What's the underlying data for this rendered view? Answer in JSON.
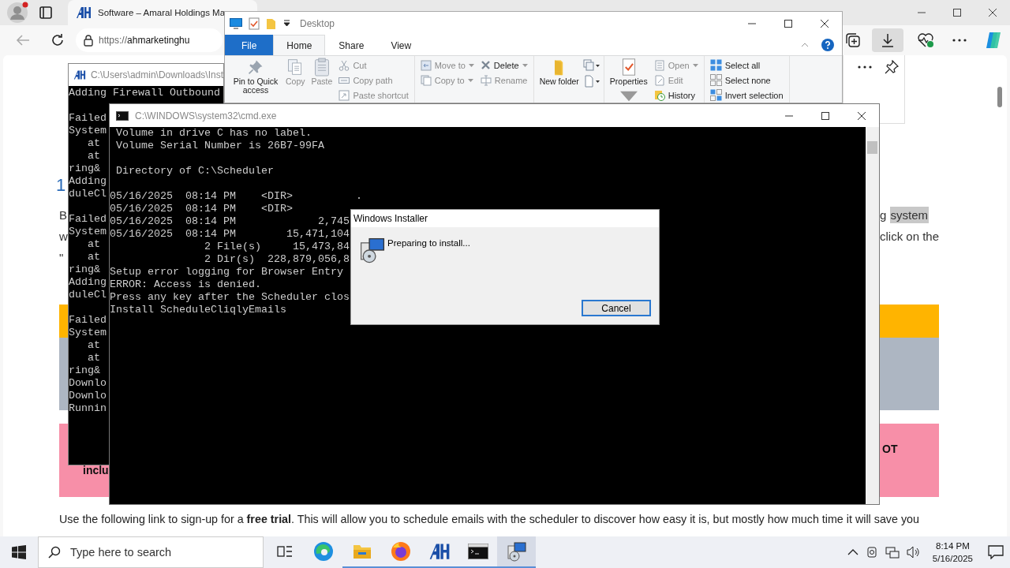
{
  "browser": {
    "tab_title": "Software – Amaral Holdings Ma",
    "address_scheme": "https://",
    "address_host": "ahmarketinghu",
    "downloads_active": true,
    "page": {
      "heading_number": "1",
      "left_fragments": [
        "B",
        "w",
        "\""
      ],
      "highlight_prefix": "g",
      "highlighted_word": "system",
      "right_line": "click on the",
      "pink_left": "inclu",
      "pink_right": "OT",
      "body_text": "Use the following link to sign-up for a **free trial**. This will allow you to schedule emails with the scheduler to discover how easy it is, but mostly how much time it will save you"
    }
  },
  "explorer": {
    "title": "Desktop",
    "tabs": [
      {
        "label": "File",
        "kind": "file",
        "selected": false
      },
      {
        "label": "Home",
        "kind": "tab",
        "selected": true
      },
      {
        "label": "Share",
        "kind": "tab",
        "selected": false
      },
      {
        "label": "View",
        "kind": "tab",
        "selected": false
      }
    ],
    "ribbon": [
      {
        "columns": [
          {
            "kind": "large",
            "items": [
              {
                "label": "Pin to Quick access",
                "disabled": false,
                "dropdown": false
              }
            ]
          },
          {
            "kind": "large",
            "items": [
              {
                "label": "Copy",
                "disabled": true,
                "dropdown": false
              }
            ]
          },
          {
            "kind": "large",
            "items": [
              {
                "label": "Paste",
                "disabled": true,
                "dropdown": false
              }
            ]
          },
          {
            "kind": "small",
            "items": [
              {
                "label": "Cut",
                "disabled": true,
                "dropdown": false
              },
              {
                "label": "Copy path",
                "disabled": true,
                "dropdown": false
              },
              {
                "label": "Paste shortcut",
                "disabled": true,
                "dropdown": false
              }
            ]
          }
        ]
      },
      {
        "columns": [
          {
            "kind": "small",
            "items": [
              {
                "label": "Move to",
                "disabled": true,
                "dropdown": true
              },
              {
                "label": "Copy to",
                "disabled": true,
                "dropdown": true
              }
            ]
          },
          {
            "kind": "small",
            "items": [
              {
                "label": "Delete",
                "disabled": false,
                "dropdown": true
              },
              {
                "label": "Rename",
                "disabled": true,
                "dropdown": false
              }
            ]
          }
        ]
      },
      {
        "columns": [
          {
            "kind": "large",
            "items": [
              {
                "label": "New folder",
                "disabled": false,
                "dropdown": false
              }
            ]
          },
          {
            "kind": "icons"
          }
        ]
      },
      {
        "columns": [
          {
            "kind": "large",
            "items": [
              {
                "label": "Properties",
                "disabled": false,
                "dropdown": true
              }
            ]
          },
          {
            "kind": "small",
            "items": [
              {
                "label": "Open",
                "disabled": true,
                "dropdown": true
              },
              {
                "label": "Edit",
                "disabled": true,
                "dropdown": false
              },
              {
                "label": "History",
                "disabled": false,
                "dropdown": false
              }
            ]
          }
        ]
      },
      {
        "columns": [
          {
            "kind": "small",
            "items": [
              {
                "label": "Select all",
                "disabled": false,
                "dropdown": false
              },
              {
                "label": "Select none",
                "disabled": false,
                "dropdown": false
              },
              {
                "label": "Invert selection",
                "disabled": false,
                "dropdown": false
              }
            ]
          }
        ]
      }
    ]
  },
  "console": {
    "title": "C:\\Users\\admin\\Downloads\\Inst",
    "blocks": [
      [
        "Adding Firewall Outbound"
      ],
      [
        "Failed",
        "System",
        "   at",
        "   at",
        "ring&",
        "Adding",
        "duleCl"
      ],
      [
        "Failed",
        "System",
        "   at",
        "   at",
        "ring&",
        "Adding",
        "duleCl"
      ],
      [
        "Failed",
        "System",
        "   at",
        "   at",
        "ring&",
        "Downlo",
        "Downlo",
        "Runnin"
      ]
    ]
  },
  "cmd": {
    "title": "C:\\WINDOWS\\system32\\cmd.exe",
    "blocks": [
      [
        " Volume in drive C has no label.",
        " Volume Serial Number is 26B7-99FA"
      ],
      [
        " Directory of C:\\Scheduler"
      ],
      [
        "05/16/2025  08:14 PM    <DIR>          .",
        "05/16/2025  08:14 PM    <DIR>",
        "05/16/2025  08:14 PM             2,745",
        "05/16/2025  08:14 PM        15,471,104",
        "               2 File(s)     15,473,84",
        "               2 Dir(s)  228,879,056,8",
        "Setup error logging for Browser Entry",
        "ERROR: Access is denied.",
        "Press any key after the Scheduler clos",
        "Install ScheduleCliqlyEmails"
      ]
    ]
  },
  "installer": {
    "title": "Windows Installer",
    "message": "Preparing to install...",
    "button": "Cancel"
  },
  "taskbar": {
    "search_placeholder": "Type here to search",
    "apps": [
      {
        "kind": "task-view",
        "running": false,
        "selected": false
      },
      {
        "kind": "edge",
        "running": false,
        "selected": false
      },
      {
        "kind": "explorer",
        "running": true,
        "selected": false
      },
      {
        "kind": "firefox",
        "running": true,
        "selected": false
      },
      {
        "kind": "ah",
        "running": true,
        "selected": false
      },
      {
        "kind": "cmd",
        "running": true,
        "selected": false
      },
      {
        "kind": "installer",
        "running": true,
        "selected": true
      }
    ],
    "time": "8:14 PM",
    "date": "5/16/2025"
  }
}
